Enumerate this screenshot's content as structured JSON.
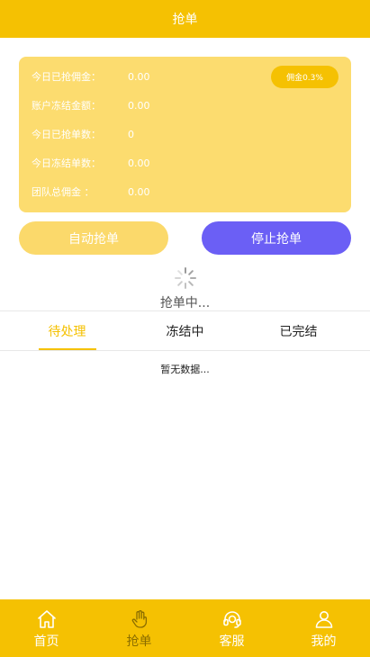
{
  "header": {
    "title": "抢单"
  },
  "stats": {
    "rows": [
      {
        "label": "今日已抢佣金：",
        "value": "0.00"
      },
      {
        "label": "账户冻结金额：",
        "value": "0.00"
      },
      {
        "label": "今日已抢单数：",
        "value": "0"
      },
      {
        "label": "今日冻结单数：",
        "value": "0.00"
      },
      {
        "label": "团队总佣金 ：",
        "value": "0.00"
      }
    ],
    "commission_badge": "佣金0.3%"
  },
  "buttons": {
    "auto_grab": "自动抢单",
    "stop_grab": "停止抢单"
  },
  "loading": {
    "text": "抢单中..."
  },
  "tabs": [
    {
      "label": "待处理",
      "active": true
    },
    {
      "label": "冻结中",
      "active": false
    },
    {
      "label": "已完结",
      "active": false
    }
  ],
  "empty_text": "暂无数据...",
  "bottom_nav": {
    "items": [
      {
        "label": "首页",
        "icon": "home-icon"
      },
      {
        "label": "抢单",
        "icon": "hand-icon"
      },
      {
        "label": "客服",
        "icon": "headset-icon"
      },
      {
        "label": "我的",
        "icon": "user-icon"
      }
    ]
  },
  "colors": {
    "primary": "#f5c102",
    "card": "#fcdc6f",
    "stop_button": "#6b5ff5"
  }
}
